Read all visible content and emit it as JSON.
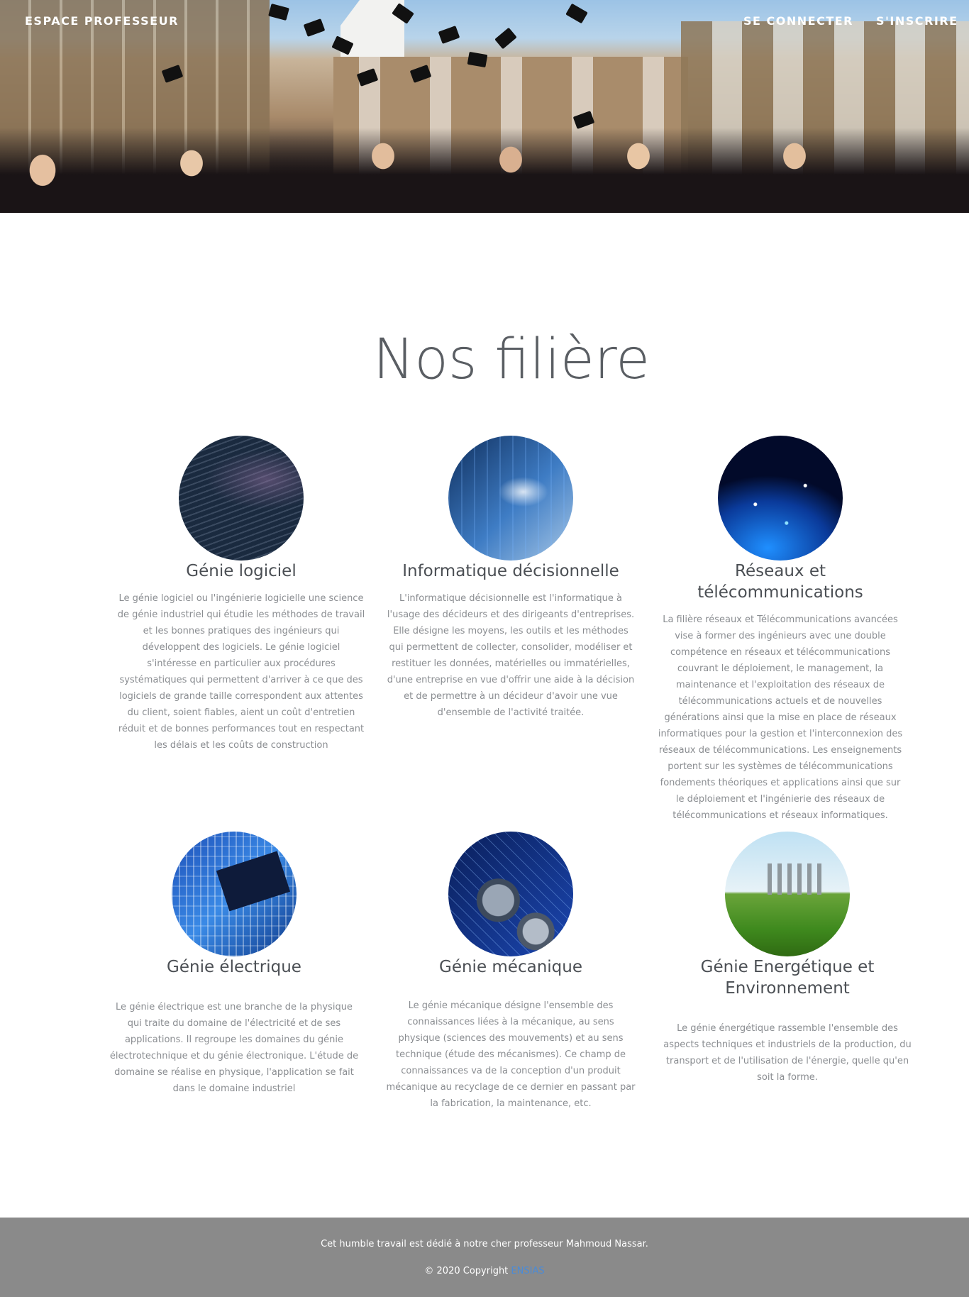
{
  "nav": {
    "brand": "ESPACE PROFESSEUR",
    "login": "SE CONNECTER",
    "signup": "S'INSCRIRE"
  },
  "section": {
    "title": "Nos filière"
  },
  "cards": [
    {
      "title": "Génie logiciel",
      "description": "Le génie logiciel ou l'ingénierie logicielle une science de génie industriel qui étudie les méthodes de travail et les bonnes pratiques des ingénieurs qui développent des logiciels. Le génie logiciel s'intéresse en particulier aux procédures systématiques qui permettent d'arriver à ce que des logiciels de grande taille correspondent aux attentes du client, soient fiables, aient un coût d'entretien réduit et de bonnes performances tout en respectant les délais et les coûts de construction"
    },
    {
      "title": "Informatique décisionnelle",
      "description": "L'informatique décisionnelle est l'informatique à l'usage des décideurs et des dirigeants d'entreprises. Elle désigne les moyens, les outils et les méthodes qui permettent de collecter, consolider, modéliser et restituer les données, matérielles ou immatérielles, d'une entreprise en vue d'offrir une aide à la décision et de permettre à un décideur d'avoir une vue d'ensemble de l'activité traitée."
    },
    {
      "title": "Réseaux et télécommunications",
      "description": "La filière réseaux et Télécommunications avancées vise à former des ingénieurs avec une double compétence en réseaux et télécommunications couvrant le déploiement, le management, la maintenance et l'exploitation des réseaux de télécommunications actuels et de nouvelles générations ainsi que la mise en place de réseaux informatiques pour la gestion et l'interconnexion des réseaux de télécommunications. Les enseignements portent sur les systèmes de télécommunications fondements théoriques et applications ainsi que sur le déploiement et l'ingénierie des réseaux de télécommunications et réseaux informatiques."
    },
    {
      "title": "Génie électrique",
      "description": "Le génie électrique est une branche de la physique qui traite du domaine de l'électricité et de ses applications. Il regroupe les domaines du génie électrotechnique et du génie électronique. L'étude de domaine se réalise en physique, l'application se fait dans le domaine industriel"
    },
    {
      "title": "Génie mécanique",
      "description": "Le génie mécanique désigne l'ensemble des connaissances liées à la mécanique, au sens physique (sciences des mouvements) et au sens technique (étude des mécanismes). Ce champ de connaissances va de la conception d'un produit mécanique au recyclage de ce dernier en passant par la fabrication, la maintenance, etc."
    },
    {
      "title": "Génie Energétique et Environnement",
      "description": "Le génie énergétique rassemble l'ensemble des aspects techniques et industriels de la production, du transport et de l'utilisation de l'énergie, quelle qu'en soit la forme."
    }
  ],
  "footer": {
    "dedication": "Cet humble travail est dédié à notre cher professeur Mahmoud Nassar.",
    "copyright": "© 2020 Copyright",
    "link": "ENSIAS"
  }
}
